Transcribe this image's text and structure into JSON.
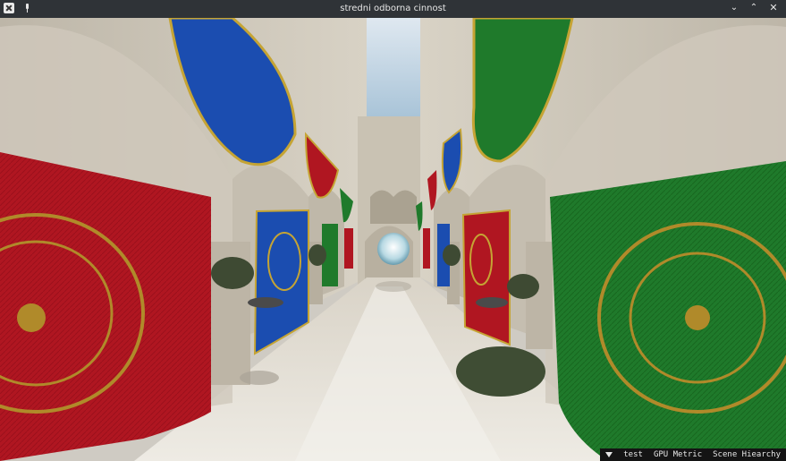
{
  "window": {
    "title": "stredni odborna cinnost"
  },
  "menubar": {
    "items": [
      {
        "label": "test"
      },
      {
        "label": "GPU Metric"
      },
      {
        "label": "Scene Hiearchy"
      }
    ]
  },
  "colors": {
    "titlebar": "#2f3337",
    "menubar": "#141414",
    "banner_red": "#b01621",
    "banner_green": "#1f7a2b",
    "banner_blue": "#1b4db0"
  }
}
